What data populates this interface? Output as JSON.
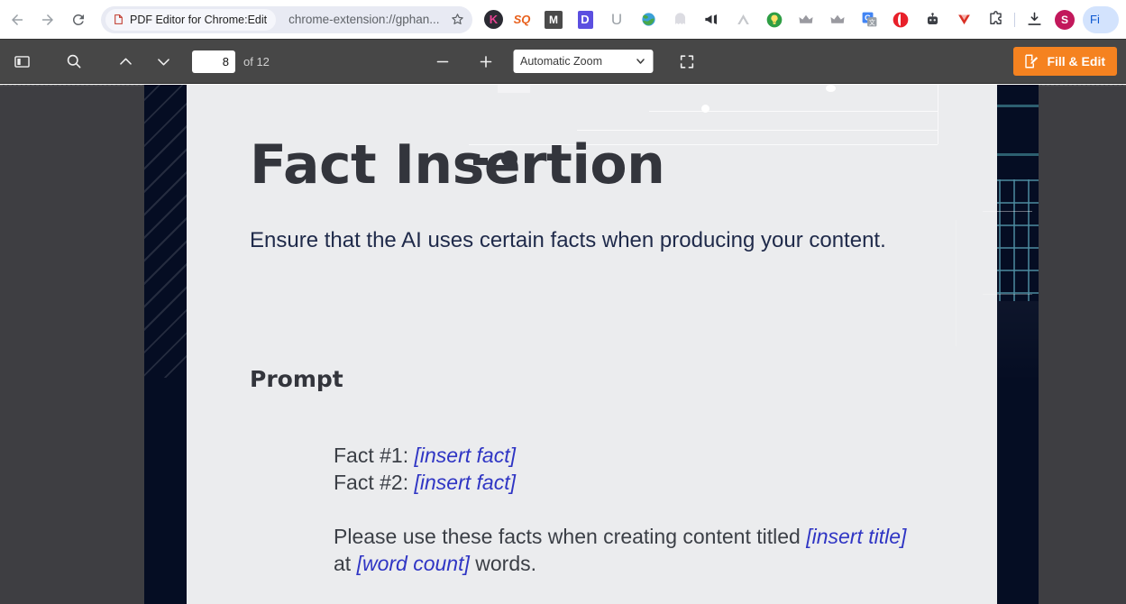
{
  "browser": {
    "back_icon": "back-arrow-icon",
    "forward_icon": "forward-arrow-icon",
    "reload_icon": "reload-icon",
    "tab_chip_label": "PDF Editor for Chrome:Edit",
    "tab_chip_favicon": "pdf-editor-favicon",
    "url": "chrome-extension://gphan...",
    "bookmark_icon": "star-icon",
    "extensions": [
      {
        "name": "kartra-extension-icon",
        "glyph": "K",
        "bg": "#2b2b33",
        "fg": "#ffffff"
      },
      {
        "name": "surfer-seo-extension-icon",
        "glyph": "SQ",
        "bg": "transparent",
        "fg": "#e8601c"
      },
      {
        "name": "mailtrack-extension-icon",
        "glyph": "M",
        "bg": "#4a4a4a",
        "fg": "#ffffff"
      },
      {
        "name": "docusign-extension-icon",
        "glyph": "D",
        "bg": "#5b4fe0",
        "fg": "#ffffff"
      },
      {
        "name": "grammarly-underline-extension-icon",
        "glyph": "U",
        "bg": "transparent",
        "fg": "#9aa0a6"
      },
      {
        "name": "globe-extension-icon",
        "glyph": "",
        "bg": "transparent",
        "fg": "#3a8f3a"
      },
      {
        "name": "ghost-extension-icon",
        "glyph": "",
        "bg": "transparent",
        "fg": "#d7d7dc"
      },
      {
        "name": "megaphone-extension-icon",
        "glyph": "",
        "bg": "transparent",
        "fg": "#2f3136"
      },
      {
        "name": "arc-extension-icon",
        "glyph": "",
        "bg": "transparent",
        "fg": "#c6c8cc"
      },
      {
        "name": "lightbulb-extension-icon",
        "glyph": "",
        "bg": "#2f9e44",
        "fg": "#ffe066"
      },
      {
        "name": "crown-extension-icon-1",
        "glyph": "",
        "bg": "transparent",
        "fg": "#9a9aa0"
      },
      {
        "name": "crown-extension-icon-2",
        "glyph": "",
        "bg": "transparent",
        "fg": "#9a9aa0"
      },
      {
        "name": "google-translate-extension-icon",
        "glyph": "G",
        "bg": "#4285f4",
        "fg": "#ffffff"
      },
      {
        "name": "opera-extension-icon",
        "glyph": "",
        "bg": "#e8202a",
        "fg": "#ffffff"
      },
      {
        "name": "robot-extension-icon",
        "glyph": "",
        "bg": "transparent",
        "fg": "#3c3f45"
      },
      {
        "name": "v-extension-icon",
        "glyph": "V",
        "bg": "transparent",
        "fg": "#d93025"
      },
      {
        "name": "extensions-puzzle-icon",
        "glyph": "",
        "bg": "transparent",
        "fg": "#3c3f45"
      }
    ],
    "downloads_icon": "download-icon",
    "avatar_initial": "S",
    "profile_label": "Fi"
  },
  "pdf_toolbar": {
    "sidebar_toggle_icon": "sidebar-toggle-icon",
    "search_icon": "search-icon",
    "prev_page_icon": "chevron-up-icon",
    "next_page_icon": "chevron-down-icon",
    "page_number": "8",
    "page_total": "of 12",
    "zoom_out_icon": "minus-icon",
    "zoom_in_icon": "plus-icon",
    "zoom_level": "Automatic Zoom",
    "zoom_caret_icon": "chevron-down-icon",
    "presentation_icon": "fullscreen-icon",
    "fill_edit_label": "Fill & Edit",
    "fill_edit_icon": "edit-document-icon",
    "accent_color": "#f58220"
  },
  "document": {
    "title": "Fact Insertion",
    "subtitle": "Ensure that the AI uses certain facts when producing your content.",
    "section_heading": "Prompt",
    "prompt": {
      "fact1_label": "Fact #1: ",
      "fact1_placeholder": "[insert fact]",
      "fact2_label": "Fact #2:  ",
      "fact2_placeholder": "[insert fact]",
      "instruction_part1": "Please use these facts when creating content titled ",
      "instruction_title_placeholder": "[insert title]",
      "instruction_part2": " at ",
      "instruction_wordcount_placeholder": "[word count]",
      "instruction_part3": " words."
    },
    "colors": {
      "page_bg": "#ebecee",
      "band_navy": "#050d23",
      "heading": "#33353c",
      "subtitle": "#1f2a4a",
      "placeholder": "#2f35c4",
      "accent_teal": "#2d5f70"
    }
  }
}
